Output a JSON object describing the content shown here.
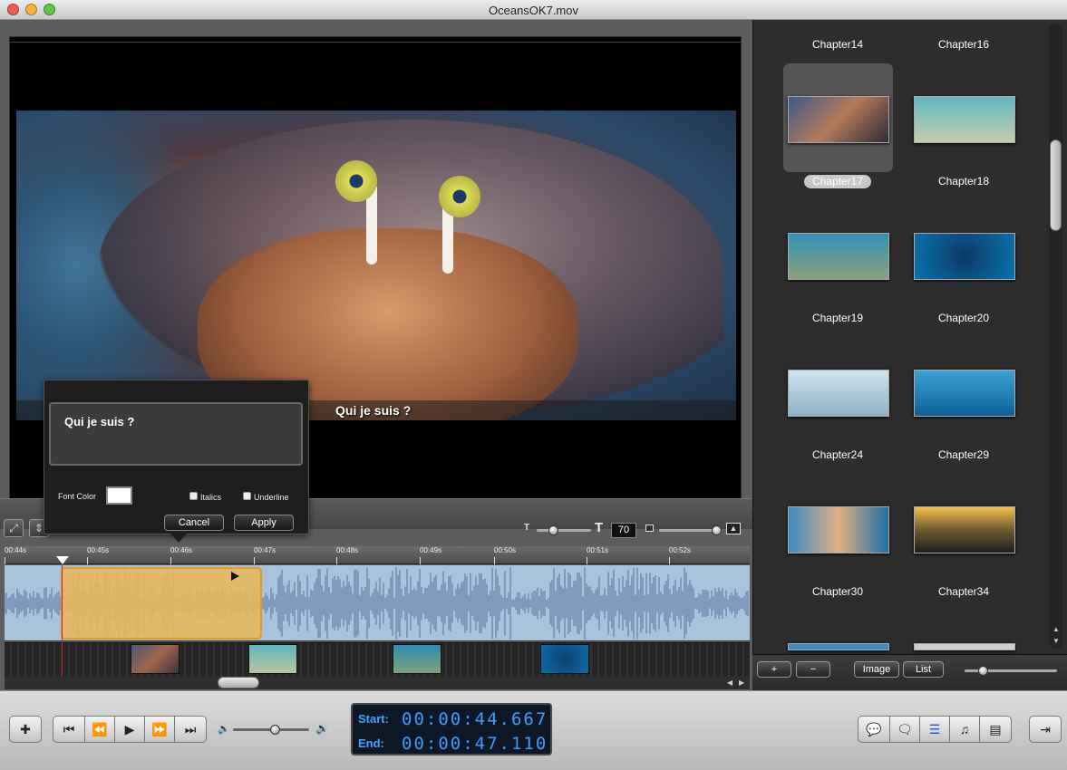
{
  "window": {
    "title": "OceansOK7.mov"
  },
  "video": {
    "subtitle": "Qui je suis ?"
  },
  "editor": {
    "text": "Qui je suis ?",
    "font_color_label": "Font Color",
    "font_color": "#ffffff",
    "italics_label": "Italics",
    "underline_label": "Underline",
    "cancel_label": "Cancel",
    "apply_label": "Apply"
  },
  "timeline_toolbar": {
    "font_size": "70",
    "font_small_icon": "T",
    "font_large_icon": "T"
  },
  "ruler": {
    "ticks": [
      "00:44s",
      "00:45s",
      "00:46s",
      "00:47s",
      "00:48s",
      "00:49s",
      "00:50s",
      "00:51s",
      "00:52s"
    ]
  },
  "chapters": [
    {
      "label": "Chapter14"
    },
    {
      "label": "Chapter16"
    },
    {
      "label": "Chapter17"
    },
    {
      "label": "Chapter18"
    },
    {
      "label": "Chapter19"
    },
    {
      "label": "Chapter20"
    },
    {
      "label": "Chapter24"
    },
    {
      "label": "Chapter29"
    },
    {
      "label": "Chapter30"
    },
    {
      "label": "Chapter34"
    }
  ],
  "chapter_bar": {
    "add": "+",
    "remove": "−",
    "image": "Image",
    "list": "List"
  },
  "timecode": {
    "start_label": "Start:",
    "start_value": "00:00:44.667",
    "end_label": "End:",
    "end_value": "00:00:47.110"
  },
  "colors": {
    "accent": "#3d9dff",
    "clip": "#ecba56",
    "waveform_bg": "#a8c4dc"
  }
}
